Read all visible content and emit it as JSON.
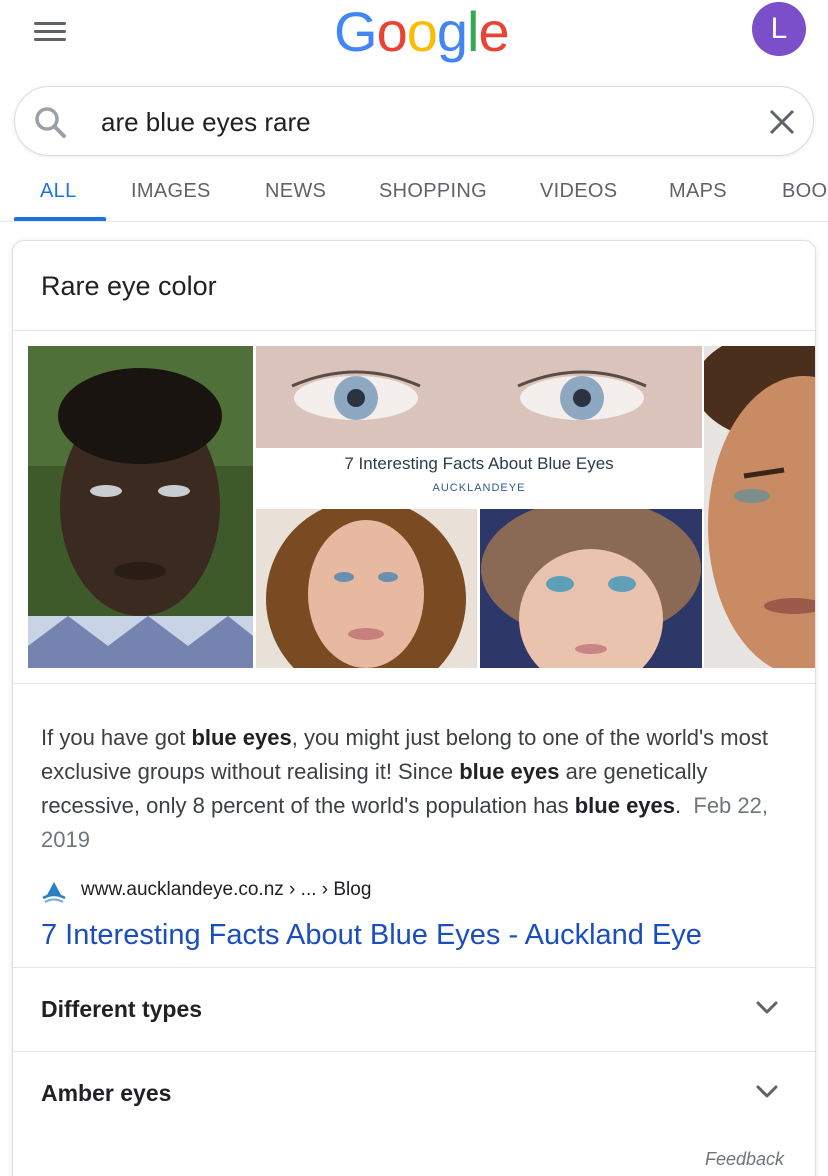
{
  "header": {
    "logo_letters": [
      "G",
      "o",
      "o",
      "g",
      "l",
      "e"
    ],
    "avatar_initial": "L"
  },
  "search": {
    "query": "are blue eyes rare"
  },
  "tabs": [
    {
      "label": "ALL",
      "active": true
    },
    {
      "label": "IMAGES"
    },
    {
      "label": "NEWS"
    },
    {
      "label": "SHOPPING"
    },
    {
      "label": "VIDEOS"
    },
    {
      "label": "MAPS"
    },
    {
      "label": "BOO"
    }
  ],
  "card": {
    "title": "Rare eye color",
    "image_caption": "7 Interesting Facts About Blue Eyes",
    "image_caption_brand": "AUCKLANDEYE",
    "snippet": {
      "parts": [
        "If you have got ",
        "blue eyes",
        ", you might just belong to one of the world's most exclusive groups without realising it! Since ",
        "blue eyes",
        " are genetically recessive, only 8 percent of the world's population has ",
        "blue eyes",
        ".",
        "Feb 22, 2019"
      ]
    },
    "source_url": "www.aucklandeye.co.nz › ... › Blog",
    "result_title": "7 Interesting Facts About Blue Eyes - Auckland Eye",
    "accordions": [
      {
        "label": "Different types"
      },
      {
        "label": "Amber eyes"
      }
    ],
    "feedback": "Feedback"
  },
  "colors": {
    "accent": "#1a73e8",
    "link": "#1a4dbd",
    "avatar": "#7b4fc9"
  },
  "icons": [
    "menu-icon",
    "search-icon",
    "close-icon",
    "site-favicon",
    "chevron-down-icon"
  ]
}
